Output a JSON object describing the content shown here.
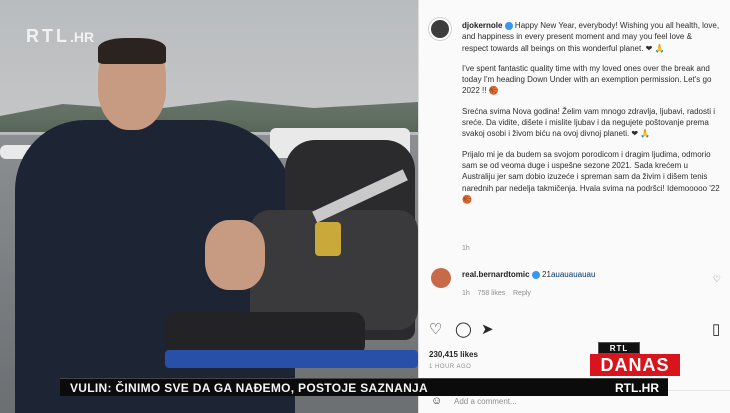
{
  "overlay": {
    "logo_text": "RTL",
    "logo_suffix": ".HR",
    "ticker_text": "VULIN: ČINIMO SVE DA GA NAĐEMO, POSTOJE SAZNANJA",
    "ticker_url": "RTL.HR",
    "danas_top": "RTL",
    "danas_bottom": "DANAS"
  },
  "post": {
    "username": "djokernole",
    "para1": "Happy New Year, everybody! Wishing you all health, love, and happiness in every present moment and may you feel love & respect towards all beings on this wonderful planet. ❤ 🙏",
    "para2": "I've spent fantastic quality time with my loved ones over the break and today I'm heading Down Under with an exemption permission. Let's go 2022 !! 🏀",
    "para3": "Srećna svima Nova godina! Želim vam mnogo zdravlja, ljubavi, radosti i sreće. Da vidite, dišete i mislite ljubav i da negujete poštovanje prema svakoj osobi i živom biću na ovoj divnoj planeti. ❤ 🙏",
    "para4": "Prijalo mi je da budem sa svojom porodicom i dragim ljudima, odmorio sam se od veoma duge i uspešne sezone 2021. Sada krećem u Australiju jer sam dobio izuzeće i spreman sam da živim i dišem tenis narednih par nedelja takmičenja. Hvala svima na podršci! Idemooooo '22 🏀",
    "time": "1h"
  },
  "comment": {
    "username": "real.bernardtomic",
    "text": "21",
    "mention": "auauauauau",
    "meta_time": "1h",
    "meta_likes": "758 likes",
    "meta_reply": "Reply"
  },
  "actions": {
    "likes": "230,415 likes",
    "date": "1 HOUR AGO",
    "add_comment_placeholder": "Add a comment..."
  },
  "colors": {
    "ticker_bg": "#0b0b0b",
    "danas_red": "#d8141c",
    "verified_blue": "#3897f0",
    "heart_red": "#d8141c"
  }
}
